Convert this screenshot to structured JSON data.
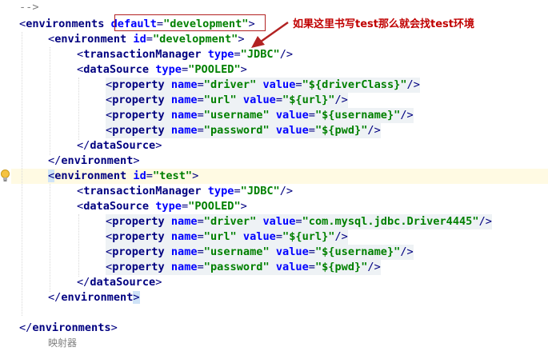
{
  "top_comment": "-->",
  "annotation": {
    "text": "如果这里书写test那么就会找test环境"
  },
  "bottom_comment": "映射器",
  "lines": [
    {
      "k": "l1",
      "text": "<environments default=\"development\">"
    },
    {
      "k": "l2",
      "text": "<environment id=\"development\">"
    },
    {
      "k": "l3",
      "text": "<transactionManager type=\"JDBC\"/>"
    },
    {
      "k": "l4",
      "text": "<dataSource type=\"POOLED\">"
    },
    {
      "k": "l5",
      "text": "<property name=\"driver\" value=\"${driverClass}\"/>"
    },
    {
      "k": "l6",
      "text": "<property name=\"url\" value=\"${url}\"/>"
    },
    {
      "k": "l7",
      "text": "<property name=\"username\" value=\"${username}\"/>"
    },
    {
      "k": "l8",
      "text": "<property name=\"password\" value=\"${pwd}\"/>"
    },
    {
      "k": "l9",
      "text": "</dataSource>"
    },
    {
      "k": "l10",
      "text": "</environment>"
    },
    {
      "k": "l11",
      "text": "<environment id=\"test\">"
    },
    {
      "k": "l12",
      "text": "<transactionManager type=\"JDBC\"/>"
    },
    {
      "k": "l13",
      "text": "<dataSource type=\"POOLED\">"
    },
    {
      "k": "l14",
      "text": "<property name=\"driver\" value=\"com.mysql.jdbc.Driver4445\"/>"
    },
    {
      "k": "l15",
      "text": "<property name=\"url\" value=\"${url}\"/>"
    },
    {
      "k": "l16",
      "text": "<property name=\"username\" value=\"${username}\"/>"
    },
    {
      "k": "l17",
      "text": "<property name=\"password\" value=\"${pwd}\"/>"
    },
    {
      "k": "l18",
      "text": "</dataSource>"
    },
    {
      "k": "l19",
      "text": "</environment>"
    },
    {
      "k": "l20",
      "text": "</environments>"
    }
  ],
  "tokens": {
    "lt": "<",
    "gt": ">",
    "sgt": "/>",
    "lts": "</",
    "eq": "=",
    "environments": "environments",
    "environment": "environment",
    "transactionManager": "transactionManager",
    "dataSource": "dataSource",
    "property": "property",
    "default": "default",
    "id": "id",
    "type": "type",
    "name": "name",
    "value": "value",
    "q_development": "\"development\"",
    "q_test": "\"test\"",
    "q_jdbc": "\"JDBC\"",
    "q_pooled": "\"POOLED\"",
    "q_driver": "\"driver\"",
    "q_url": "\"url\"",
    "q_username": "\"username\"",
    "q_password": "\"password\"",
    "q_driverClass": "\"${driverClass}\"",
    "q_urlv": "\"${url}\"",
    "q_usernamev": "\"${username}\"",
    "q_pwd": "\"${pwd}\"",
    "q_mysql": "\"com.mysql.jdbc.Driver4445\""
  },
  "colors": {
    "callout": "#b22222",
    "annotation": "#c00000",
    "tag": "#000080",
    "attribute": "#0000ff",
    "value": "#008000"
  },
  "icons": {
    "gutter": "lightbulb-icon",
    "arrow": "callout-arrow-icon"
  }
}
